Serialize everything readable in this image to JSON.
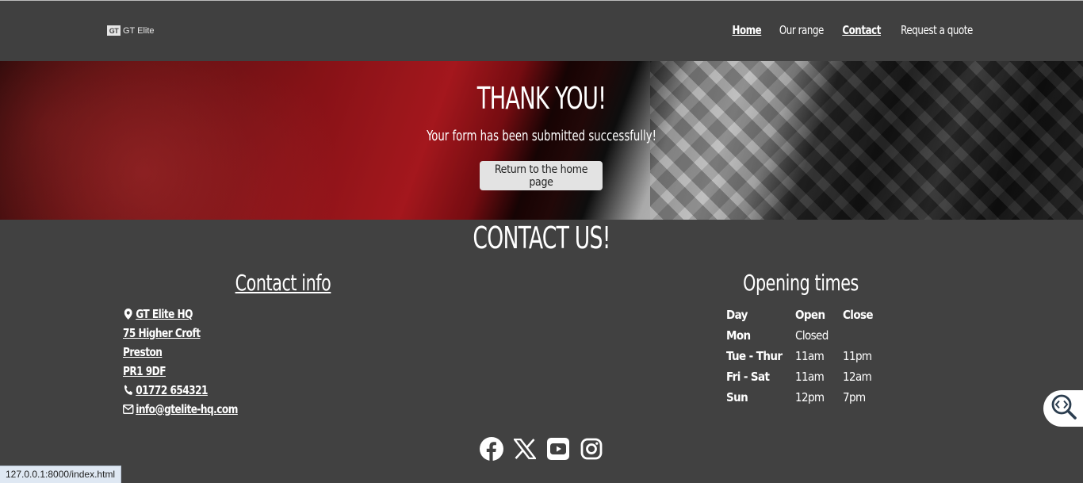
{
  "header": {
    "logo_mark": "GT",
    "logo_text": "GT Elite",
    "nav": [
      "Home",
      "Our range",
      "Contact",
      "Request a quote"
    ]
  },
  "hero": {
    "title": "THANK YOU!",
    "subtitle": "Your form has been submitted successfully!",
    "button": "Return to the home page"
  },
  "contact": {
    "title": "CONTACT US!",
    "info_title": "Contact info",
    "address": [
      "GT Elite HQ",
      "75 Higher Croft",
      "Preston",
      "PR1 9DF"
    ],
    "phone": "01772 654321",
    "email": "info@gtelite-hq.com",
    "times_title": "Opening times",
    "times_headers": [
      "Day",
      "Open",
      "Close"
    ],
    "times": [
      {
        "day": "Mon",
        "open": "Closed",
        "close": ""
      },
      {
        "day": "Tue - Thur",
        "open": "11am",
        "close": "11pm"
      },
      {
        "day": "Fri - Sat",
        "open": "11am",
        "close": "12am"
      },
      {
        "day": "Sun",
        "open": "12pm",
        "close": "7pm"
      }
    ]
  },
  "social": [
    "facebook-icon",
    "x-icon",
    "youtube-icon",
    "instagram-icon"
  ],
  "status_url": "127.0.0.1:8000/index.html",
  "colors": {
    "background": "#414141",
    "header": "#404040",
    "button": "#e3e3e3"
  }
}
